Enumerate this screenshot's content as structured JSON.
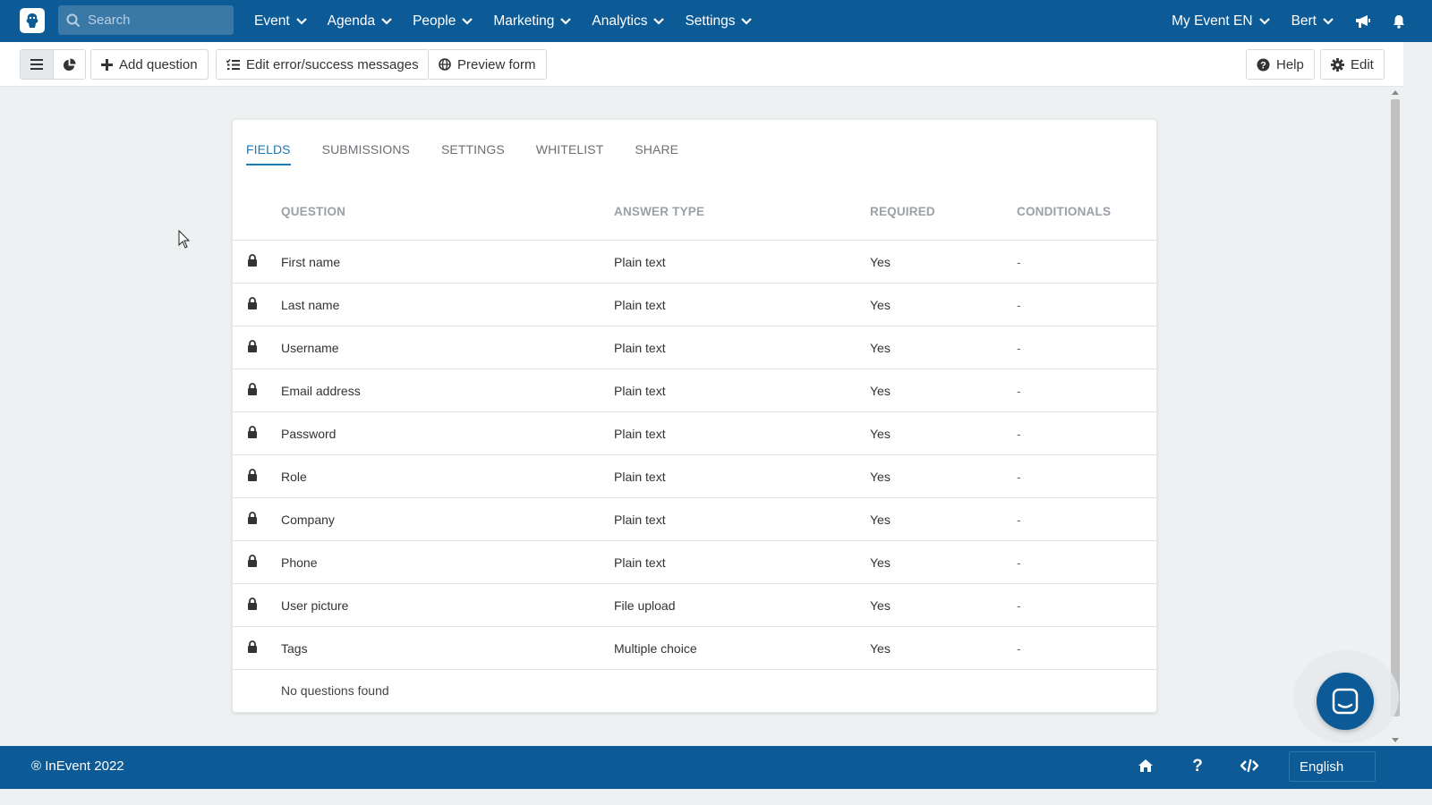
{
  "topnav": {
    "search_placeholder": "Search",
    "menu": [
      {
        "label": "Event"
      },
      {
        "label": "Agenda"
      },
      {
        "label": "People"
      },
      {
        "label": "Marketing"
      },
      {
        "label": "Analytics"
      },
      {
        "label": "Settings"
      }
    ],
    "event_selector": "My Event EN",
    "user": "Bert"
  },
  "toolbar": {
    "add_question": "Add question",
    "edit_messages": "Edit error/success messages",
    "preview_form": "Preview form",
    "help": "Help",
    "edit": "Edit"
  },
  "tabs": [
    "FIELDS",
    "SUBMISSIONS",
    "SETTINGS",
    "WHITELIST",
    "SHARE"
  ],
  "active_tab": "FIELDS",
  "table": {
    "headers": {
      "question": "QUESTION",
      "answer_type": "ANSWER TYPE",
      "required": "REQUIRED",
      "conditionals": "CONDITIONALS"
    },
    "rows": [
      {
        "question": "First name",
        "answer_type": "Plain text",
        "required": "Yes",
        "conditionals": "-"
      },
      {
        "question": "Last name",
        "answer_type": "Plain text",
        "required": "Yes",
        "conditionals": "-"
      },
      {
        "question": "Username",
        "answer_type": "Plain text",
        "required": "Yes",
        "conditionals": "-"
      },
      {
        "question": "Email address",
        "answer_type": "Plain text",
        "required": "Yes",
        "conditionals": "-"
      },
      {
        "question": "Password",
        "answer_type": "Plain text",
        "required": "Yes",
        "conditionals": "-"
      },
      {
        "question": "Role",
        "answer_type": "Plain text",
        "required": "Yes",
        "conditionals": "-"
      },
      {
        "question": "Company",
        "answer_type": "Plain text",
        "required": "Yes",
        "conditionals": "-"
      },
      {
        "question": "Phone",
        "answer_type": "Plain text",
        "required": "Yes",
        "conditionals": "-"
      },
      {
        "question": "User picture",
        "answer_type": "File upload",
        "required": "Yes",
        "conditionals": "-"
      },
      {
        "question": "Tags",
        "answer_type": "Multiple choice",
        "required": "Yes",
        "conditionals": "-"
      }
    ],
    "empty_message": "No questions found"
  },
  "footer": {
    "copyright": "® InEvent 2022",
    "language": "English"
  },
  "colors": {
    "brand": "#0c5a96",
    "accent": "#1d7ab8",
    "background": "#eef1f1"
  },
  "icons": [
    "search-icon",
    "chevron-down-icon",
    "megaphone-icon",
    "bell-icon",
    "menu-list-icon",
    "pie-chart-icon",
    "plus-icon",
    "list-check-icon",
    "globe-icon",
    "help-circle-icon",
    "gear-icon",
    "lock-icon",
    "chat-icon",
    "home-icon",
    "question-icon",
    "code-icon"
  ]
}
